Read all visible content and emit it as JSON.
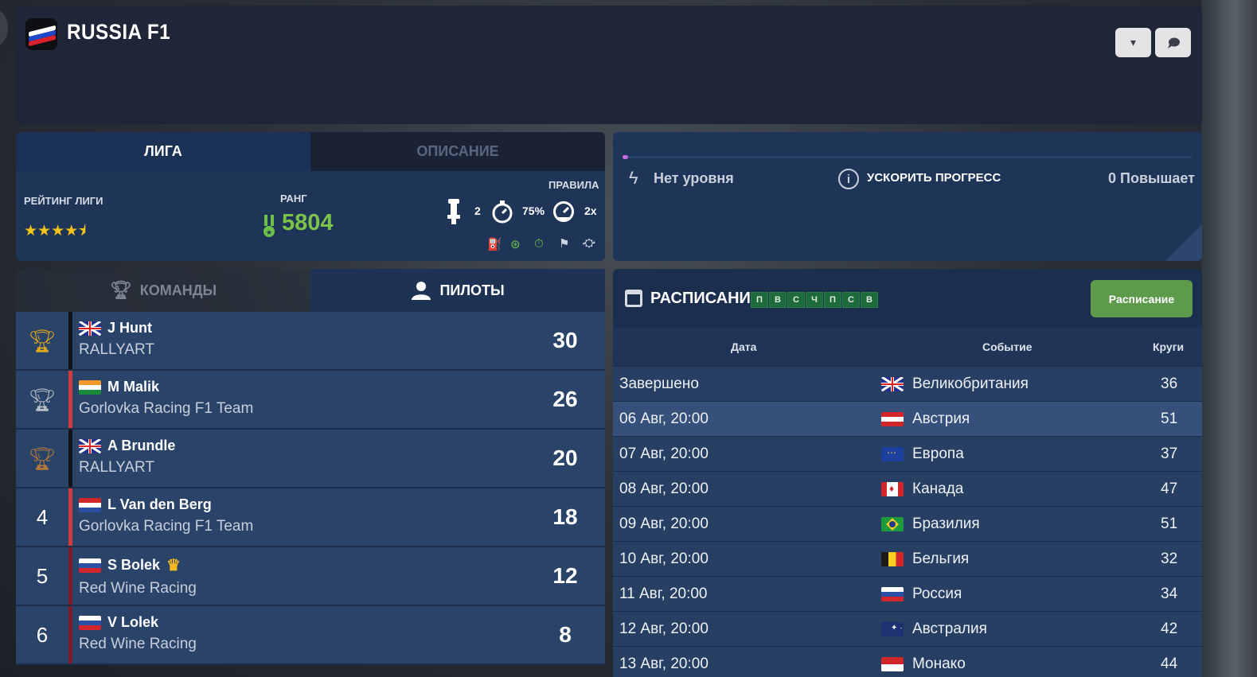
{
  "header": {
    "title": "RUSSIA F1"
  },
  "league_tabs": [
    {
      "label": "ЛИГА",
      "active": true
    },
    {
      "label": "ОПИСАНИЕ",
      "active": false
    }
  ],
  "league_stats": {
    "rating_label": "РЕЙТИНГ ЛИГИ",
    "rating_stars": 4.5,
    "stars_display": "★★★★⯨",
    "rank_label": "РАНГ",
    "rank_value": "5804",
    "rules_label": "ПРАВИЛА",
    "rule_values": [
      "2",
      "75%",
      "2x"
    ]
  },
  "progress": {
    "level_text": "Нет уровня",
    "boost_text": "УСКОРИТЬ ПРОГРЕСС",
    "boosts_text": "0 Повышает",
    "fill_fraction": 0.01
  },
  "driver_tabs": [
    {
      "label": "КОМАНДЫ",
      "active": false
    },
    {
      "label": "ПИЛОТЫ",
      "active": true
    }
  ],
  "drivers": [
    {
      "pos": "",
      "trophy": "gold",
      "flag": "gb",
      "name": "J Hunt",
      "team": "RALLYART",
      "points": "30",
      "bar": "#111418",
      "crown": false
    },
    {
      "pos": "",
      "trophy": "silver",
      "flag": "in",
      "name": "M Malik",
      "team": "Gorlovka Racing F1 Team",
      "points": "26",
      "bar": "#d23a3f",
      "crown": false
    },
    {
      "pos": "",
      "trophy": "bronze",
      "flag": "gb",
      "name": "A Brundle",
      "team": "RALLYART",
      "points": "20",
      "bar": "#111418",
      "crown": false
    },
    {
      "pos": "4",
      "trophy": "",
      "flag": "nl",
      "name": "L Van den Berg",
      "team": "Gorlovka Racing F1 Team",
      "points": "18",
      "bar": "#d23a3f",
      "crown": false
    },
    {
      "pos": "5",
      "trophy": "",
      "flag": "ru",
      "name": "S Bolek",
      "team": "Red Wine Racing",
      "points": "12",
      "bar": "#7a1a2a",
      "crown": true
    },
    {
      "pos": "6",
      "trophy": "",
      "flag": "ru",
      "name": "V Lolek",
      "team": "Red Wine Racing",
      "points": "8",
      "bar": "#7a1a2a",
      "crown": false
    }
  ],
  "schedule": {
    "title": "РАСПИСАНИЕ",
    "days": [
      "П",
      "В",
      "С",
      "Ч",
      "П",
      "С",
      "В"
    ],
    "button_label": "Расписание",
    "columns": {
      "date": "Дата",
      "event": "Событие",
      "laps": "Круги"
    },
    "rows": [
      {
        "date": "Завершено",
        "flag": "gb",
        "event": "Великобритания",
        "laps": "36"
      },
      {
        "date": "06 Авг, 20:00",
        "flag": "at",
        "event": "Австрия",
        "laps": "51"
      },
      {
        "date": "07 Авг, 20:00",
        "flag": "eu",
        "event": "Европа",
        "laps": "37"
      },
      {
        "date": "08 Авг, 20:00",
        "flag": "ca",
        "event": "Канада",
        "laps": "47"
      },
      {
        "date": "09 Авг, 20:00",
        "flag": "br",
        "event": "Бразилия",
        "laps": "51"
      },
      {
        "date": "10 Авг, 20:00",
        "flag": "be",
        "event": "Бельгия",
        "laps": "32"
      },
      {
        "date": "11 Авг, 20:00",
        "flag": "ru",
        "event": "Россия",
        "laps": "34"
      },
      {
        "date": "12 Авг, 20:00",
        "flag": "au",
        "event": "Австралия",
        "laps": "42"
      },
      {
        "date": "13 Авг, 20:00",
        "flag": "mc",
        "event": "Монако",
        "laps": "44"
      }
    ]
  },
  "colors": {
    "panel": "#1f3557",
    "accent_green": "#7cc14a",
    "gold": "#f5c418",
    "button_green": "#5e9a4c"
  }
}
